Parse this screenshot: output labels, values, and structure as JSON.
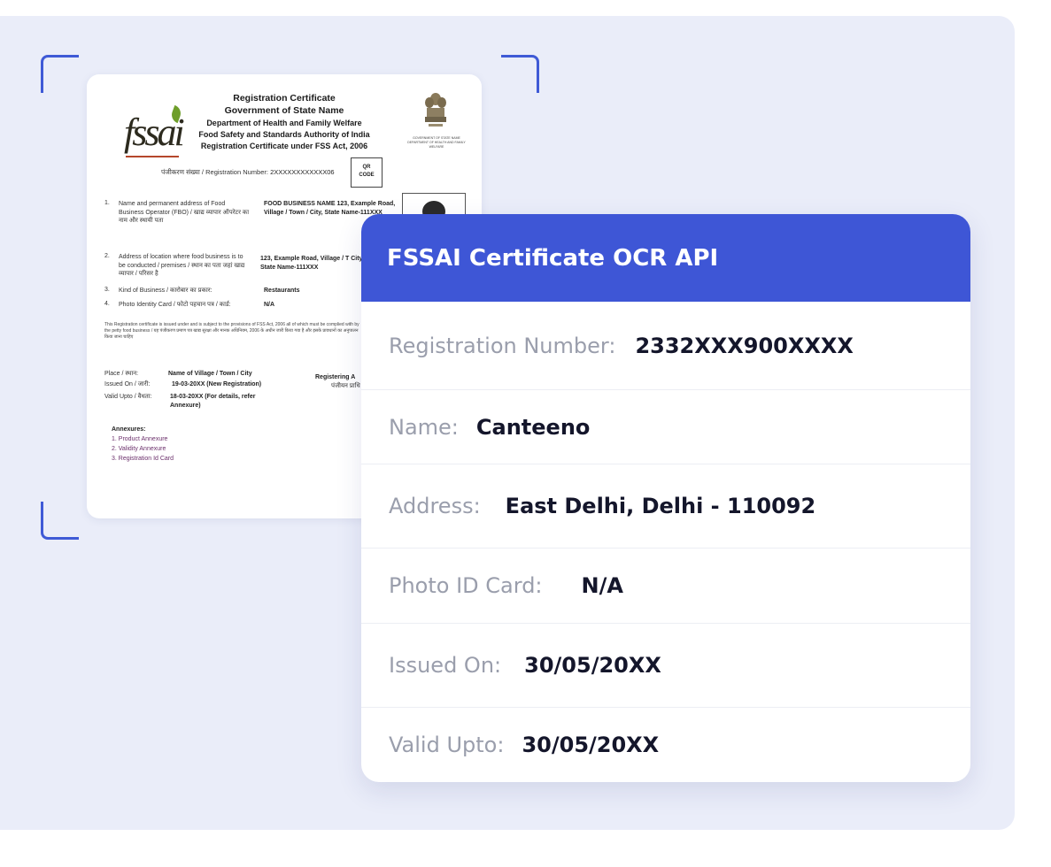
{
  "certificate": {
    "logo_text": "fssai",
    "title": "Registration Certificate",
    "subtitle": "Government of State Name",
    "dept": "Department of Health and Family Welfare",
    "authority": "Food Safety and Standards Authority of India",
    "act": "Registration Certificate under FSS Act, 2006",
    "reg_label": "पंजीकरण संख्या / Registration Number:",
    "reg_number": "2XXXXXXXXXXXX06",
    "qr_l1": "QR",
    "qr_l2": "CODE",
    "items": [
      {
        "num": "1.",
        "label": "Name and permanent address of Food Business Operator (FBO) / खाद्य व्यापार ऑपरेटर का नाम और स्थायी पता",
        "value": "FOOD BUSINESS NAME 123, Example Road, Village / Town / City, State Name-111XXX"
      },
      {
        "num": "2.",
        "label": "Address of location where food business is to be conducted / premises / स्थान का पता जहां खाद्य व्यापार / परिसर है",
        "value": "123, Example Road, Village / T City, State Name-111XXX"
      },
      {
        "num": "3.",
        "label": "Kind of Business / कारोबार का प्रकार:",
        "value": "Restaurants"
      },
      {
        "num": "4.",
        "label": "Photo Identity Card / फोटो पहचान पत्र / कार्ड:",
        "value": "N/A"
      }
    ],
    "notice": "This Registration certificate is issued under and is subject to the provisions of FSS Act, 2006 all of which must be complied with by the petty food business / यह पंजीकरण प्रमाण पत्र खाद्य सुरक्षा और मानक अधिनियम, 2006 के अधीन जारी किया गया है और इसके प्रावधानों का अनुपालन किया जाना चाहिए",
    "place_label": "Place / स्थान:",
    "place_value": "Name of Village / Town / City",
    "issued_label": "Issued On / जारी:",
    "issued_value": "19-03-20XX (New Registration)",
    "valid_label": "Valid Upto / वैधता:",
    "valid_value": "18-03-20XX (For details, refer Annexure)",
    "registering": "Registering A",
    "registering_hi": "पंजीयन प्राधि",
    "annex_title": "Annexures:",
    "annexures": [
      "1. Product Annexure",
      "2. Validity Annexure",
      "3. Registration Id Card"
    ],
    "emblem_caption": "GOVERNMENT OF STATE NAME DEPARTMENT OF HEALTH AND FAMILY WELFARE"
  },
  "ocr": {
    "title": "FSSAI Certificate OCR API",
    "fields": [
      {
        "label": "Registration Number:",
        "value": "2332XXX900XXXX"
      },
      {
        "label": "Name:",
        "value": "Canteeno"
      },
      {
        "label": "Address:",
        "value": "East Delhi, Delhi - 110092"
      },
      {
        "label": "Photo ID Card:",
        "value": "N/A"
      },
      {
        "label": "Issued On:",
        "value": "30/05/20XX"
      },
      {
        "label": "Valid Upto:",
        "value": "30/05/20XX"
      }
    ]
  },
  "colors": {
    "accent": "#3e56d6",
    "panel_bg": "#eaedf9",
    "label_gray": "#9a9eac",
    "value_dark": "#14162b"
  }
}
